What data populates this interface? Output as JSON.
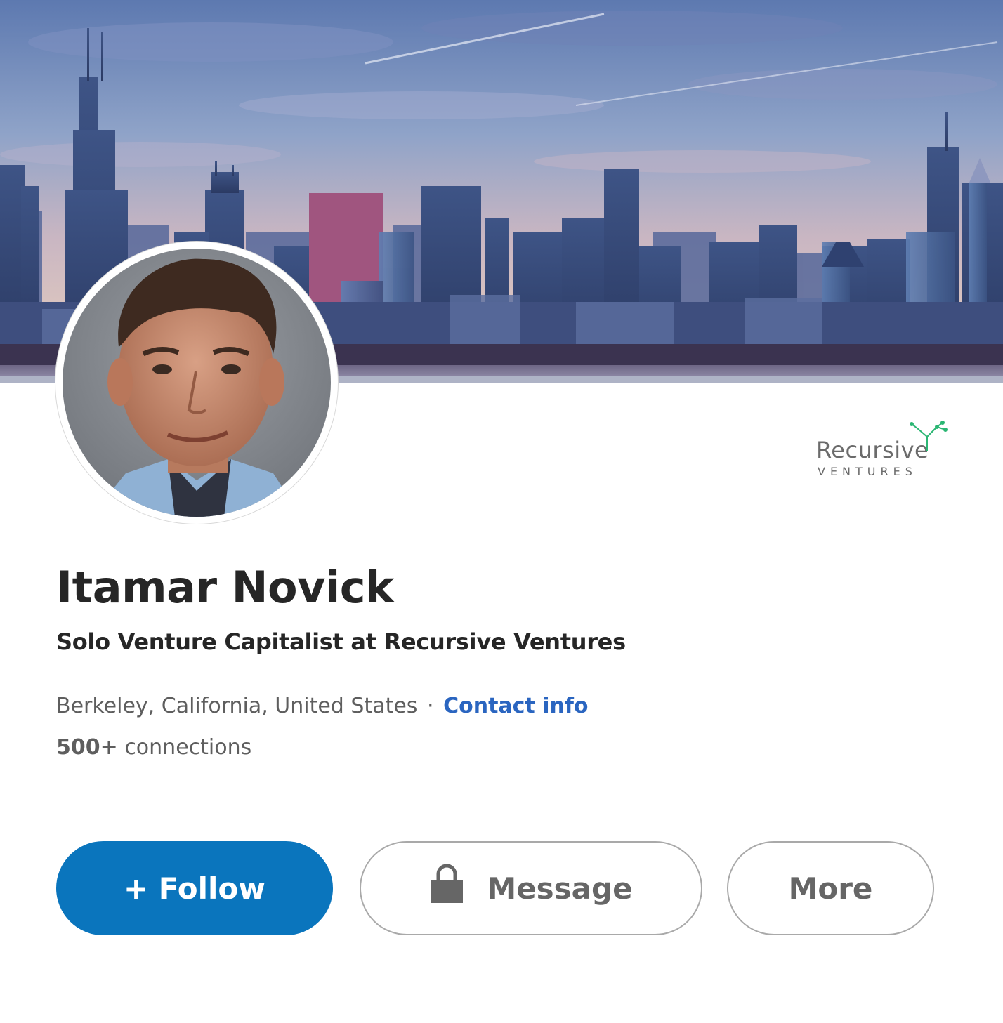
{
  "profile": {
    "name": "Itamar Novick",
    "headline": "Solo Venture Capitalist at Recursive Ventures",
    "location": "Berkeley, California, United States",
    "separator": "·",
    "contact_link": "Contact info",
    "connections_count": "500+",
    "connections_label": "connections"
  },
  "company": {
    "logo_word": "Recursive",
    "logo_sub": "VENTURES"
  },
  "actions": {
    "follow_label": "+ Follow",
    "message_label": "Message",
    "more_label": "More"
  },
  "icons": {
    "message": "lock-icon",
    "cover": "city-skyline-image",
    "avatar": "profile-photo"
  },
  "colors": {
    "primary": "#0a75bd",
    "link": "#2a65c0",
    "text": "#262626",
    "muted": "#5e5e5e",
    "logo_accent": "#2bb673"
  }
}
